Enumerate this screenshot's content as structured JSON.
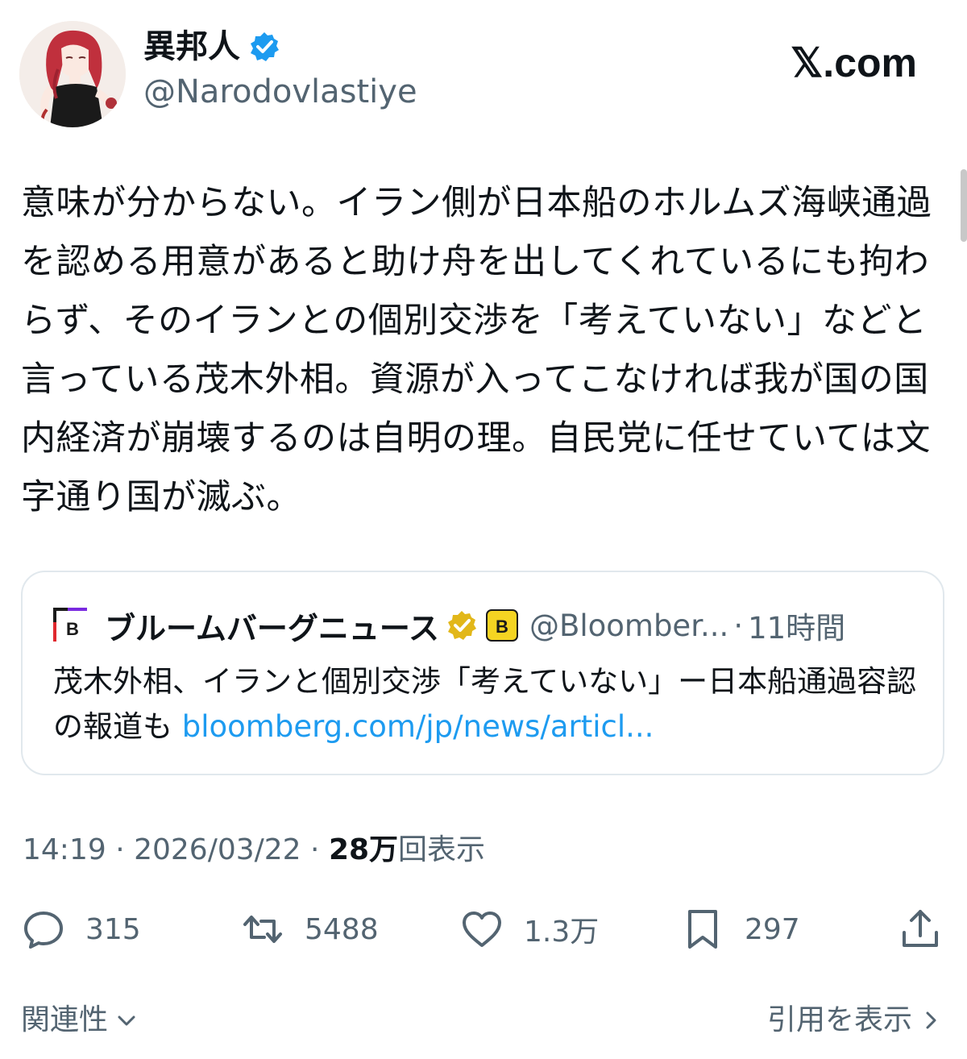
{
  "author": {
    "display_name": "異邦人",
    "handle": "@Narodovlastiye",
    "verified_icon": "verified-badge-icon",
    "verified_color": "#1d9bf0"
  },
  "site_logo": "𝕏.com",
  "tweet": {
    "text": "意味が分からない。イラン側が日本船のホルムズ海峡通過を認める用意があると助け舟を出してくれているにも拘わらず、そのイランとの個別交渉を「考えていない」などと言っている茂木外相。資源が入ってこなければ我が国の国内経済が崩壊するのは自明の理。自民党に任せていては文字通り国が滅ぶ。"
  },
  "quote": {
    "name": "ブルームバーグニュース",
    "handle": "@Bloomber...",
    "separator": "·",
    "time": "11時間",
    "text": "茂木外相、イランと個別交渉「考えていない」ー日本船通過容認の報道も ",
    "link": "bloomberg.com/jp/news/articl...",
    "badge_color": "#e2b719",
    "badge_letter": "B",
    "logo_letter": "B",
    "link_color": "#1d9bf0"
  },
  "meta": {
    "time": "14:19",
    "dot1": " · ",
    "date": "2026/03/22",
    "dot2": " · ",
    "views_count": "28万",
    "views_label": "回表示"
  },
  "actions": {
    "reply_count": "315",
    "retweet_count": "5488",
    "like_count": "1.3万",
    "bookmark_count": "297"
  },
  "footer": {
    "relevance_label": "関連性",
    "quotes_label": "引用を表示"
  }
}
